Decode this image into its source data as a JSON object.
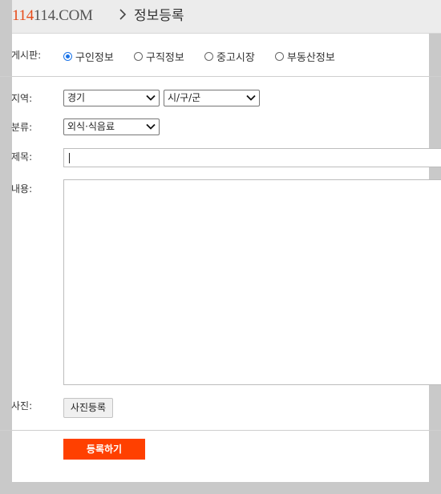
{
  "header": {
    "logo_red": "114",
    "logo_rest": "114.COM",
    "title": "정보등록"
  },
  "form": {
    "board": {
      "label": "게시판:",
      "options": [
        "구인정보",
        "구직정보",
        "중고시장",
        "부동산정보"
      ],
      "selected": "구인정보"
    },
    "region": {
      "label": "지역:",
      "province": "경기",
      "city": "시/구/군"
    },
    "category": {
      "label": "분류:",
      "value": "외식·식음료"
    },
    "title_field": {
      "label": "제목:",
      "value": ""
    },
    "content": {
      "label": "내용:",
      "value": ""
    },
    "photo": {
      "label": "사진:",
      "button": "사진등록"
    },
    "submit": "등록하기"
  },
  "colors": {
    "brand_red": "#e64a19",
    "submit_bg": "#ff4000",
    "radio_accent": "#1a73e8"
  }
}
